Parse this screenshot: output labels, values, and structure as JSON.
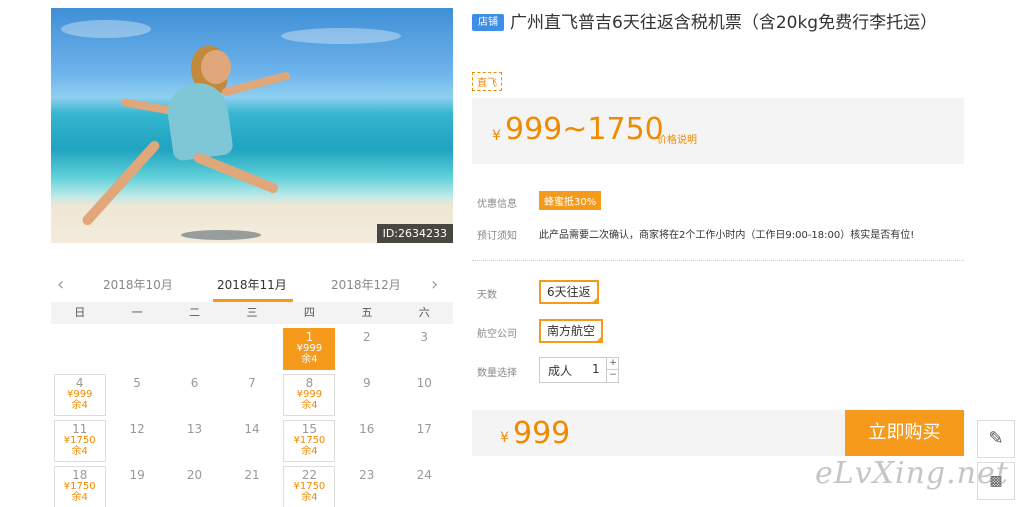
{
  "photo": {
    "id_label": "ID:2634233"
  },
  "calendar": {
    "prev_month": "2018年10月",
    "current_month": "2018年11月",
    "next_month": "2018年12月",
    "weekdays": [
      "日",
      "一",
      "二",
      "三",
      "四",
      "五",
      "六"
    ],
    "rows": [
      [
        {
          "day": ""
        },
        {
          "day": ""
        },
        {
          "day": ""
        },
        {
          "day": ""
        },
        {
          "day": "1",
          "price": "¥999",
          "remain": "余4",
          "selected": true
        },
        {
          "day": "2"
        },
        {
          "day": "3"
        }
      ],
      [
        {
          "day": "4",
          "price": "¥999",
          "remain": "余4"
        },
        {
          "day": "5"
        },
        {
          "day": "6"
        },
        {
          "day": "7"
        },
        {
          "day": "8",
          "price": "¥999",
          "remain": "余4"
        },
        {
          "day": "9"
        },
        {
          "day": "10"
        }
      ],
      [
        {
          "day": "11",
          "price": "¥1750",
          "remain": "余4"
        },
        {
          "day": "12"
        },
        {
          "day": "13"
        },
        {
          "day": "14"
        },
        {
          "day": "15",
          "price": "¥1750",
          "remain": "余4"
        },
        {
          "day": "16"
        },
        {
          "day": "17"
        }
      ],
      [
        {
          "day": "18",
          "price": "¥1750",
          "remain": "余4"
        },
        {
          "day": "19"
        },
        {
          "day": "20"
        },
        {
          "day": "21"
        },
        {
          "day": "22",
          "price": "¥1750",
          "remain": "余4"
        },
        {
          "day": "23"
        },
        {
          "day": "24"
        }
      ]
    ]
  },
  "product": {
    "shop_tag": "店铺",
    "title": "广州直飞普吉6天往返含税机票（含20kg免费行李托运）",
    "direct_tag": "直飞",
    "price_symbol": "¥",
    "price_range": "999~1750",
    "price_explain": "价格说明",
    "promo_label": "优惠信息",
    "promo_tag": "蜂蜜抵30%",
    "booking_label": "预订须知",
    "booking_notice": "此产品需要二次确认，商家将在2个工作小时内（工作日9:00-18:00）核实是否有位!",
    "days_label": "天数",
    "days_value": "6天往返",
    "airline_label": "航空公司",
    "airline_value": "南方航空",
    "qty_label": "数量选择",
    "qty_type": "成人",
    "qty_value": "1",
    "qty_plus": "+",
    "qty_minus": "−",
    "total_symbol": "¥",
    "total_price": "999",
    "buy_label": "立即购买"
  },
  "side": {
    "watermark": "eLvXing.net"
  },
  "colors": {
    "accent": "#f59a1b",
    "price": "#f08a00",
    "shop_tag": "#3c8ee6"
  }
}
